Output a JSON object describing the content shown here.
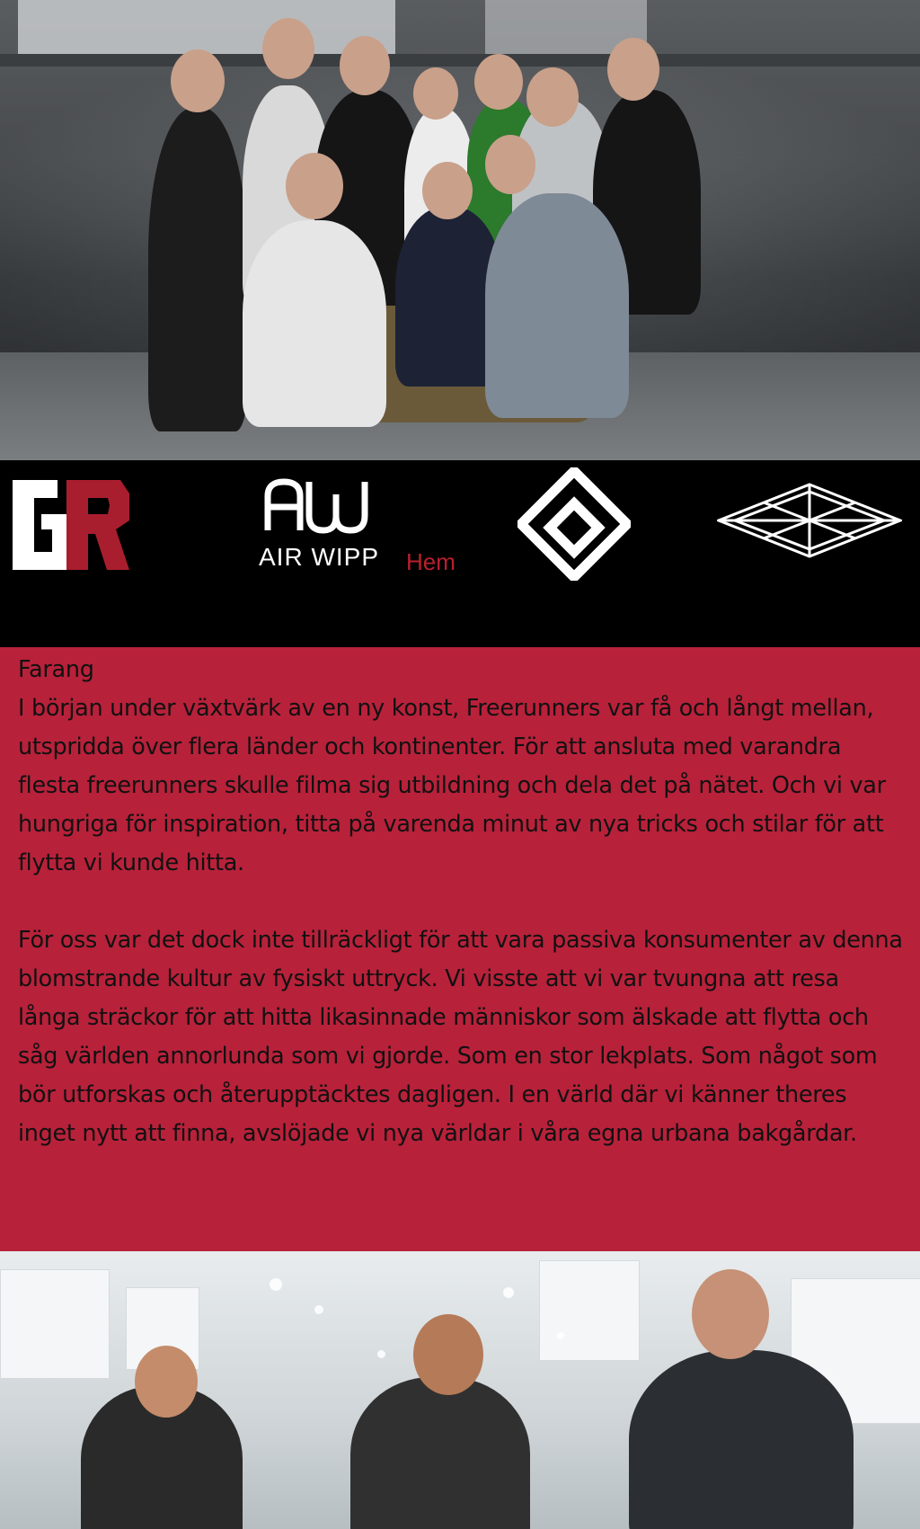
{
  "logos": {
    "gr": "GR",
    "airwipp_mark": "AW",
    "airwipp_text": "AIR WIPP"
  },
  "nav": {
    "home_label": "Hem"
  },
  "content": {
    "title": "Farang",
    "paragraph1": "I början under växtvärk av en ny konst, Freerunners var få och långt mellan, utspridda över flera länder och kontinenter. För att ansluta med varandra flesta freerunners skulle filma sig utbildning och dela det på nätet. Och vi var hungriga för inspiration, titta på varenda minut av nya tricks och stilar för att flytta vi kunde hitta.",
    "paragraph2": "För oss var det dock inte tillräckligt för att vara passiva konsumenter av denna blomstrande kultur av fysiskt uttryck. Vi visste att vi var tvungna att resa långa sträckor för att hitta likasinnade människor som älskade att flytta och såg världen annorlunda som vi gjorde. Som en stor lekplats. Som något som bör utforskas och återupptäcktes dagligen. I en värld där vi känner theres inget nytt att finna, avslöjade vi nya världar i våra egna urbana bakgårdar."
  },
  "colors": {
    "brand_red": "#b8213a",
    "link_red": "#b7202f",
    "bar_black": "#000000"
  }
}
